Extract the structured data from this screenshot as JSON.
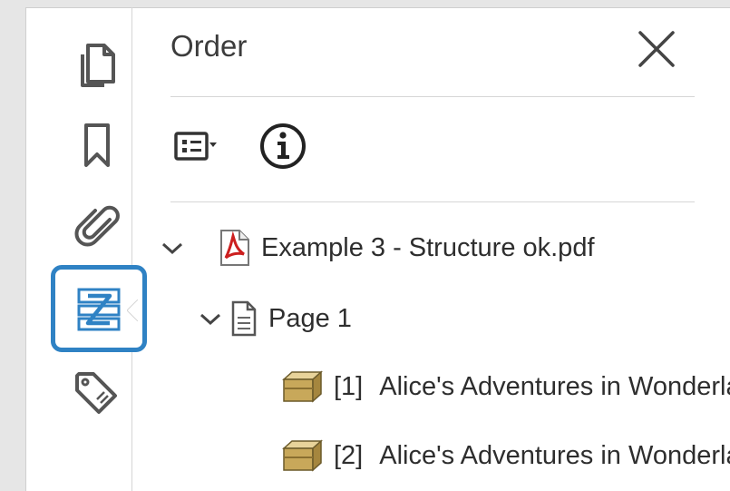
{
  "window": {
    "panel_title": "Order"
  },
  "rail": {
    "items": [
      {
        "name": "pages-icon"
      },
      {
        "name": "bookmark-icon"
      },
      {
        "name": "attachment-icon"
      },
      {
        "name": "order-icon",
        "active": true
      },
      {
        "name": "tags-icon"
      }
    ]
  },
  "colors": {
    "accent": "#2f82c4",
    "pdf_red": "#cc1f1f",
    "box_tan": "#c8a85a"
  },
  "tree": {
    "document": "Example 3 - Structure ok.pdf",
    "page": "Page 1",
    "items": [
      {
        "index": "[1]",
        "text": "Alice's Adventures in Wonderland"
      },
      {
        "index": "[2]",
        "text": "Alice's Adventures in Wonderland"
      }
    ]
  }
}
